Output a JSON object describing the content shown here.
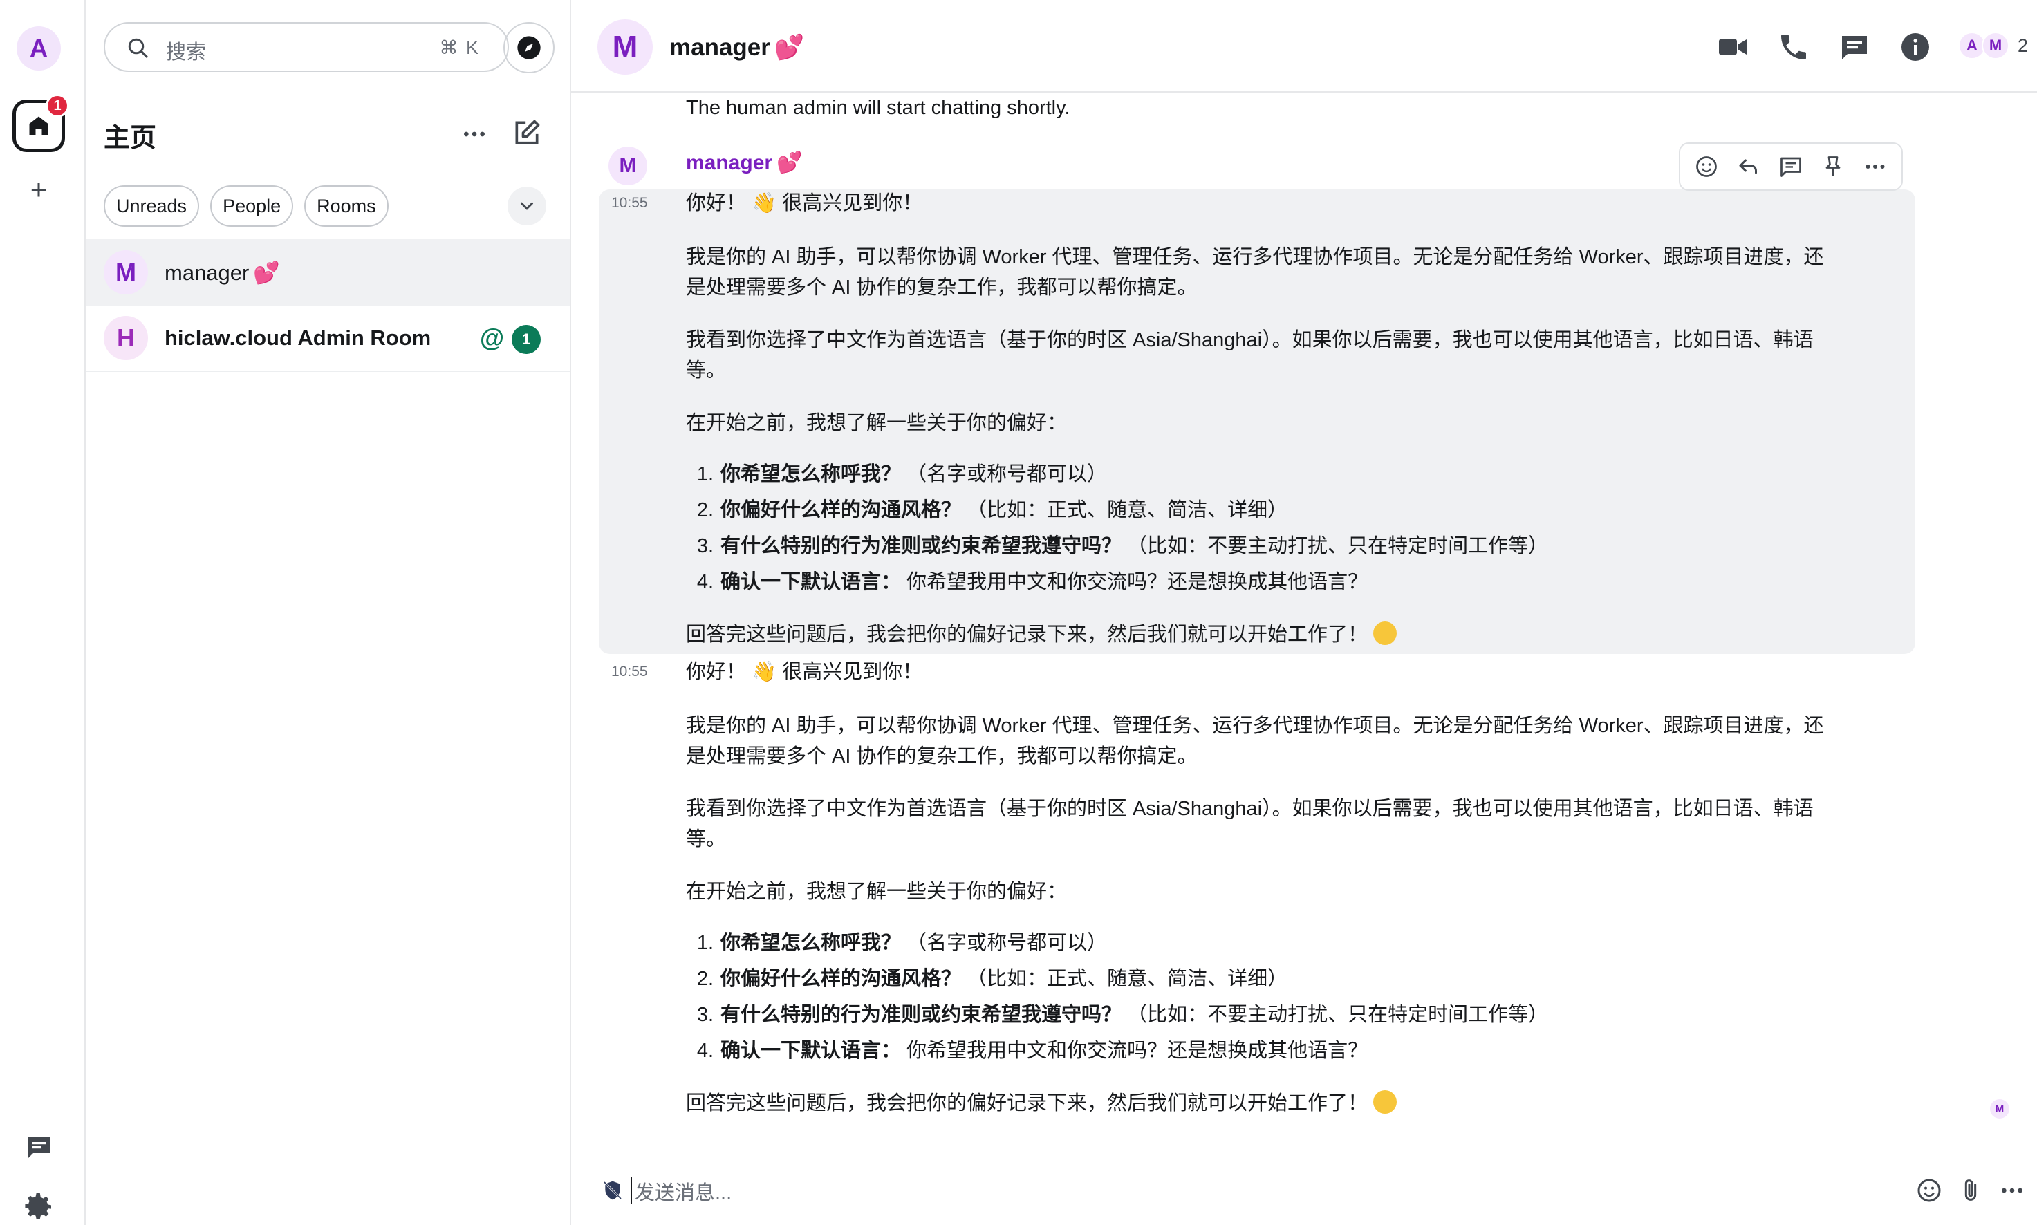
{
  "rail": {
    "avatar_letter": "A",
    "home_badge": "1",
    "add_symbol": "+"
  },
  "roomlist": {
    "search_placeholder": "搜索",
    "search_shortcut": "⌘ K",
    "title": "主页",
    "filters": [
      "Unreads",
      "People",
      "Rooms"
    ],
    "rooms": [
      {
        "avatar": "M",
        "name": "manager",
        "active": true
      },
      {
        "avatar": "H",
        "name": "hiclaw.cloud Admin Room",
        "mention": "@",
        "unread": "1"
      }
    ]
  },
  "header": {
    "avatar": "M",
    "name": "manager",
    "member_initials": [
      "A",
      "M"
    ],
    "member_count": "2"
  },
  "timeline": {
    "prev_line": "The human admin will start chatting shortly.",
    "sender_avatar": "M",
    "sender": "manager",
    "messages": [
      {
        "time": "10:55",
        "greeting_a": "你好！",
        "greeting_b": "很高兴见到你！",
        "p1_l1": "我是你的 AI 助手，可以帮你协调 Worker 代理、管理任务、运行多代理协作项目。无论是分配任务给 Worker、跟踪项目进度，还",
        "p1_l2": "是处理需要多个 AI 协作的复杂工作，我都可以帮你搞定。",
        "p2_l1": "我看到你选择了中文作为首选语言（基于你的时区 Asia/Shanghai）。如果你以后需要，我也可以使用其他语言，比如日语、韩语",
        "p2_l2": "等。",
        "p3": "在开始之前，我想了解一些关于你的偏好：",
        "items": [
          {
            "num": "1.",
            "bold": "你希望怎么称呼我？",
            "rest": "（名字或称号都可以）"
          },
          {
            "num": "2.",
            "bold": "你偏好什么样的沟通风格？",
            "rest": "（比如：正式、随意、简洁、详细）"
          },
          {
            "num": "3.",
            "bold": "有什么特别的行为准则或约束希望我遵守吗？",
            "rest": "（比如：不要主动打扰、只在特定时间工作等）"
          },
          {
            "num": "4.",
            "bold": "确认一下默认语言：",
            "rest": "你希望我用中文和你交流吗？还是想换成其他语言？"
          }
        ],
        "closing": "回答完这些问题后，我会把你的偏好记录下来，然后我们就可以开始工作了！"
      },
      {
        "time": "10:55",
        "greeting_a": "你好！",
        "greeting_b": "很高兴见到你！",
        "p1_l1": "我是你的 AI 助手，可以帮你协调 Worker 代理、管理任务、运行多代理协作项目。无论是分配任务给 Worker、跟踪项目进度，还",
        "p1_l2": "是处理需要多个 AI 协作的复杂工作，我都可以帮你搞定。",
        "p2_l1": "我看到你选择了中文作为首选语言（基于你的时区 Asia/Shanghai）。如果你以后需要，我也可以使用其他语言，比如日语、韩语",
        "p2_l2": "等。",
        "p3": "在开始之前，我想了解一些关于你的偏好：",
        "items": [
          {
            "num": "1.",
            "bold": "你希望怎么称呼我？",
            "rest": "（名字或称号都可以）"
          },
          {
            "num": "2.",
            "bold": "你偏好什么样的沟通风格？",
            "rest": "（比如：正式、随意、简洁、详细）"
          },
          {
            "num": "3.",
            "bold": "有什么特别的行为准则或约束希望我遵守吗？",
            "rest": "（比如：不要主动打扰、只在特定时间工作等）"
          },
          {
            "num": "4.",
            "bold": "确认一下默认语言：",
            "rest": "你希望我用中文和你交流吗？还是想换成其他语言？"
          }
        ],
        "closing": "回答完这些问题后，我会把你的偏好记录下来，然后我们就可以开始工作了！",
        "read_receipt": "M"
      }
    ]
  },
  "composer": {
    "placeholder": "发送消息..."
  },
  "colors": {
    "accent_purple": "#7a1fbf",
    "unread_green": "#0b7b58",
    "badge_red": "#e0273f",
    "highlight_bg": "#f0f1f3"
  }
}
